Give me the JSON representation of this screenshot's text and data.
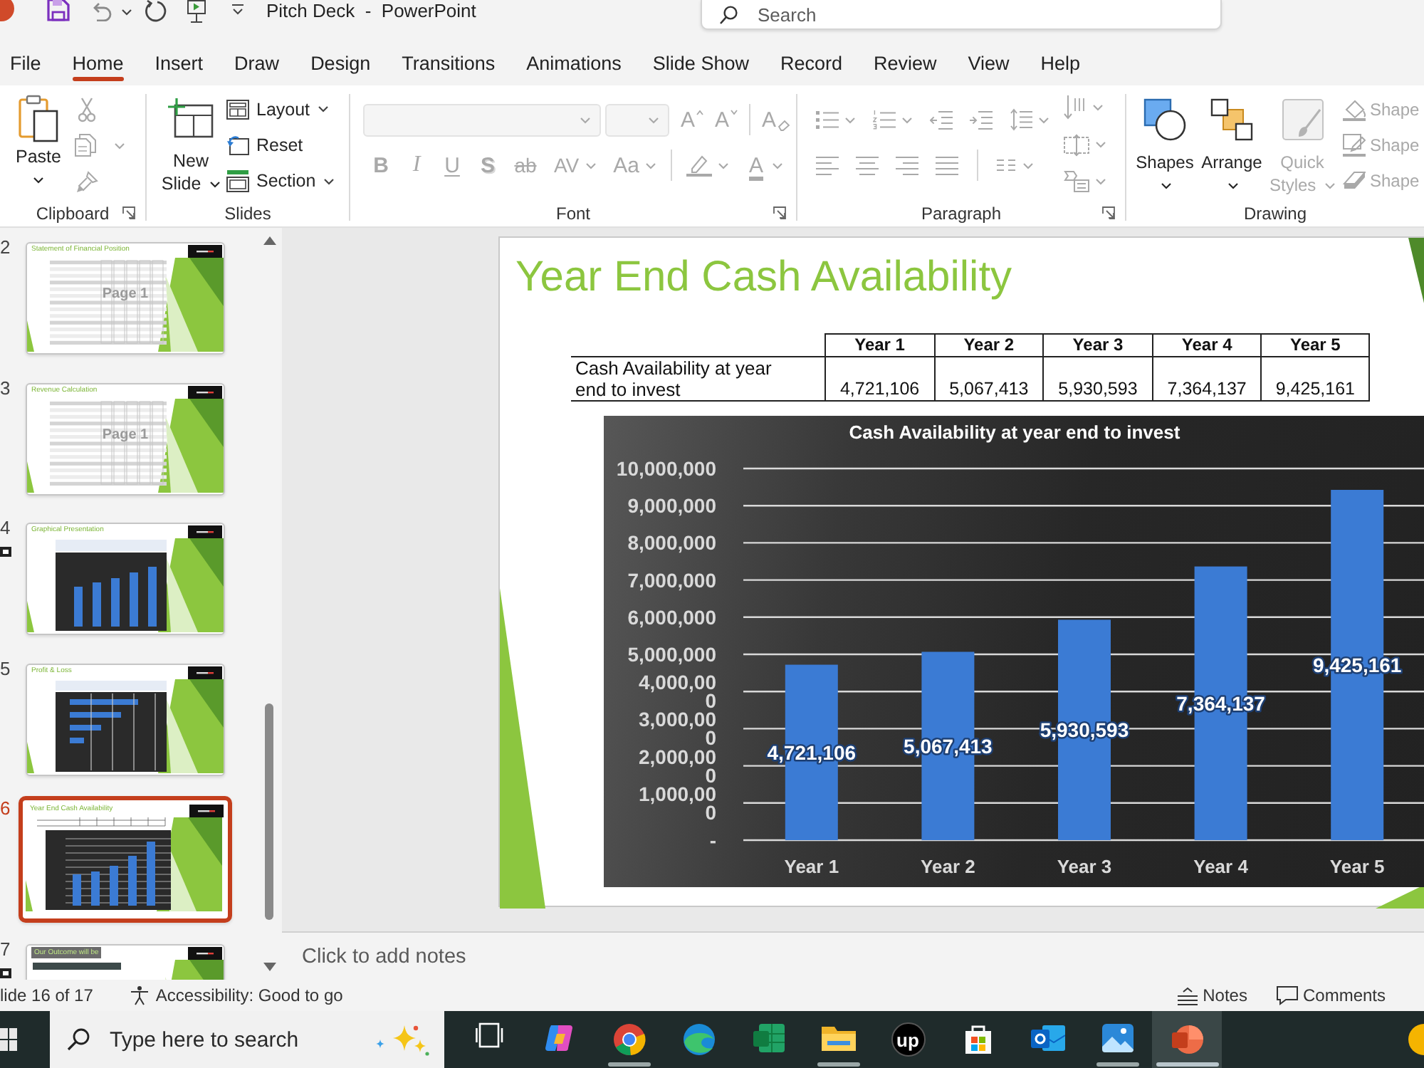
{
  "title_bar": {
    "title": "Pitch Deck  -  PowerPoint",
    "search": {
      "placeholder": "Search"
    }
  },
  "tabs": [
    {
      "label": "File",
      "selected": false
    },
    {
      "label": "Home",
      "selected": true
    },
    {
      "label": "Insert",
      "selected": false
    },
    {
      "label": "Draw",
      "selected": false
    },
    {
      "label": "Design",
      "selected": false
    },
    {
      "label": "Transitions",
      "selected": false
    },
    {
      "label": "Animations",
      "selected": false
    },
    {
      "label": "Slide Show",
      "selected": false
    },
    {
      "label": "Record",
      "selected": false
    },
    {
      "label": "Review",
      "selected": false
    },
    {
      "label": "View",
      "selected": false
    },
    {
      "label": "Help",
      "selected": false
    }
  ],
  "ribbon": {
    "clipboard": {
      "label": "Clipboard",
      "launcher": true,
      "paste": {
        "label": "Paste",
        "disabled": false
      },
      "tools_disabled": true
    },
    "slides": {
      "label": "Slides",
      "new_slide": {
        "label": "New Slide"
      },
      "items": [
        {
          "kind": "layout",
          "label": "Layout",
          "menu": true
        },
        {
          "kind": "reset",
          "label": "Reset",
          "menu": false
        },
        {
          "kind": "section",
          "label": "Section",
          "menu": true
        }
      ]
    },
    "font": {
      "label": "Font",
      "launcher": true,
      "disabled": true,
      "sizing": [
        {
          "kind": "grow",
          "glyph": "A"
        },
        {
          "kind": "shrink",
          "glyph": "A"
        },
        {
          "kind": "clear",
          "glyph": "A"
        }
      ],
      "formats": [
        {
          "kind": "bold",
          "glyph": "B"
        },
        {
          "kind": "italic",
          "glyph": "I"
        },
        {
          "kind": "underline",
          "glyph": "U"
        },
        {
          "kind": "shadow",
          "glyph": "S"
        },
        {
          "kind": "strikethrough",
          "glyph": "ab"
        },
        {
          "kind": "spacing",
          "glyph": "AV"
        },
        {
          "kind": "case",
          "glyph": "Aa"
        },
        {
          "kind": "highlight"
        },
        {
          "kind": "color",
          "glyph": "A"
        }
      ]
    },
    "paragraph": {
      "label": "Paragraph",
      "launcher": true,
      "disabled": true
    },
    "drawing": {
      "label": "Drawing",
      "buttons": [
        {
          "kind": "shapes",
          "label": "Shapes",
          "disabled": false
        },
        {
          "kind": "arrange",
          "label": "Arrange",
          "disabled": false
        },
        {
          "kind": "quick-styles",
          "label": "Quick Styles",
          "disabled": true
        }
      ],
      "shape_format": [
        {
          "kind": "fill",
          "label": "Shape",
          "disabled": true
        },
        {
          "kind": "outline",
          "label": "Shape",
          "disabled": true
        },
        {
          "kind": "effects",
          "label": "Shape",
          "disabled": true
        }
      ]
    }
  },
  "slide_panel": {
    "slides": [
      {
        "number": "2",
        "title": "Statement of Financial Position",
        "kind": "table",
        "overlay_text": "Page 1",
        "selected": false
      },
      {
        "number": "3",
        "title": "Revenue Calculation",
        "kind": "table",
        "overlay_text": "Page 1",
        "selected": false
      },
      {
        "number": "4",
        "title": "Graphical Presentation",
        "kind": "column-chart",
        "selected": false,
        "animated": true
      },
      {
        "number": "5",
        "title": "Profit & Loss",
        "kind": "bar-chart",
        "selected": false
      },
      {
        "number": "6",
        "title": "Year End Cash Availability",
        "kind": "table-chart",
        "selected": true
      },
      {
        "number": "7",
        "title": "Our Outcome will be",
        "kind": "text",
        "selected": false,
        "animated": true
      }
    ]
  },
  "slide": {
    "title": "Year End Cash Availability",
    "table": {
      "columns": [
        "Year 1",
        "Year 2",
        "Year 3",
        "Year 4",
        "Year 5"
      ],
      "rows": [
        {
          "label": "Cash Availability at year end to invest",
          "values": [
            "4,721,106",
            "5,067,413",
            "5,930,593",
            "7,364,137",
            "9,425,161"
          ]
        }
      ]
    },
    "chart_data": {
      "type": "bar",
      "title": "Cash Availability at year end to invest",
      "categories": [
        "Year 1",
        "Year 2",
        "Year 3",
        "Year 4",
        "Year 5"
      ],
      "series": [
        {
          "color": "#3b7bd4",
          "values": [
            4721106,
            5067413,
            5930593,
            7364137,
            9425161
          ]
        }
      ],
      "ylim": [
        0,
        10000000
      ],
      "yticks": [
        {
          "value": 0,
          "label": "-"
        },
        {
          "value": 1000000,
          "label": "1,000,00\n0"
        },
        {
          "value": 2000000,
          "label": "2,000,00\n0"
        },
        {
          "value": 3000000,
          "label": "3,000,00\n0"
        },
        {
          "value": 4000000,
          "label": "4,000,00\n0"
        },
        {
          "value": 5000000,
          "label": "5,000,000"
        },
        {
          "value": 6000000,
          "label": "6,000,000"
        },
        {
          "value": 7000000,
          "label": "7,000,000"
        },
        {
          "value": 8000000,
          "label": "8,000,000"
        },
        {
          "value": 9000000,
          "label": "9,000,000"
        },
        {
          "value": 10000000,
          "label": "10,000,000"
        }
      ],
      "grid": true,
      "value_labels": [
        "4,721,106",
        "5,067,413",
        "5,930,593",
        "7,364,137",
        "9,425,161"
      ]
    }
  },
  "notes": {
    "placeholder": "Click to add notes"
  },
  "status_bar": {
    "slide_info": "lide 16 of 17",
    "accessibility": "Accessibility: Good to go",
    "buttons": [
      {
        "kind": "notes",
        "label": "Notes"
      },
      {
        "kind": "comments",
        "label": "Comments"
      }
    ]
  },
  "taskbar": {
    "search": {
      "placeholder": "Type here to search"
    },
    "apps": [
      {
        "kind": "task-view",
        "running": false,
        "selected": false
      },
      {
        "kind": "copilot",
        "running": false,
        "selected": false
      },
      {
        "kind": "chrome",
        "running": true,
        "selected": false
      },
      {
        "kind": "edge",
        "running": false,
        "selected": false
      },
      {
        "kind": "excel",
        "running": false,
        "selected": false
      },
      {
        "kind": "explorer",
        "running": true,
        "selected": false
      },
      {
        "kind": "upwork",
        "glyph": "up",
        "running": false,
        "selected": false
      },
      {
        "kind": "store",
        "running": false,
        "selected": false
      },
      {
        "kind": "outlook",
        "running": false,
        "selected": false
      },
      {
        "kind": "photos",
        "running": true,
        "selected": false
      },
      {
        "kind": "powerpoint",
        "running": true,
        "selected": true
      }
    ]
  }
}
